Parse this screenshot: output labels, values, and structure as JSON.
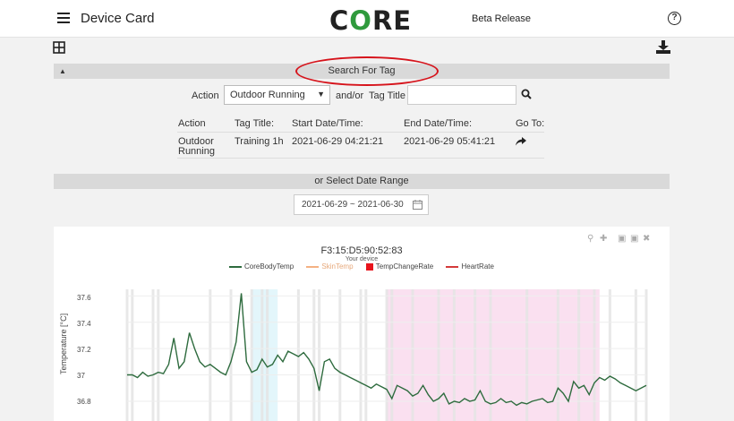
{
  "header": {
    "title": "Device Card",
    "logo_text_1": "C",
    "logo_text_2": "O",
    "logo_text_3": "RE",
    "beta_label": "Beta Release",
    "help_label": "?"
  },
  "toolbar": {
    "icons": [
      "grid-icon",
      "download-icon"
    ]
  },
  "search_panel": {
    "header": "Search For Tag",
    "caret": "▲",
    "action_label": "Action",
    "action_value": "Outdoor Running",
    "andor_label": "and/or",
    "tag_title_label": "Tag Title",
    "tag_title_value": "",
    "highlight_color": "#d6131b"
  },
  "results_table": {
    "headers": [
      "Action",
      "Tag Title:",
      "Start Date/Time:",
      "End Date/Time:",
      "Go To:"
    ],
    "rows": [
      {
        "action_line1": "Outdoor",
        "action_line2": "Running",
        "tag_title": "Training 1h",
        "start": "2021-06-29 04:21:21",
        "end": "2021-06-29 05:41:21"
      }
    ]
  },
  "date_panel": {
    "header": "or Select Date Range",
    "range_value": "2021-06-29 ~ 2021-06-30"
  },
  "chart_controls": [
    "zoom-icon",
    "pan-icon",
    "zoom-in-icon",
    "zoom-out-icon",
    "reset-axes-icon"
  ],
  "chart_data": {
    "type": "line",
    "title": "F3:15:D5:90:52:83",
    "subtitle": "Your device",
    "ylabel": "Temperature [°C]",
    "ylim": [
      36.65,
      37.65
    ],
    "yticks": [
      "37.6",
      "37.4",
      "37.2",
      "37",
      "36.8"
    ],
    "legend": [
      {
        "name": "CoreBodyTemp",
        "color": "#2e6b3e",
        "kind": "line"
      },
      {
        "name": "SkinTemp",
        "color": "#f4b183",
        "kind": "line"
      },
      {
        "name": "TempChangeRate",
        "color": "#e8141c",
        "kind": "box"
      },
      {
        "name": "HeartRate",
        "color": "#d43a3a",
        "kind": "line"
      }
    ],
    "series": [
      {
        "name": "CoreBodyTemp",
        "x": [
          0,
          1,
          2,
          3,
          4,
          5,
          6,
          7,
          8,
          9,
          10,
          11,
          12,
          13,
          14,
          15,
          16,
          17,
          18,
          19,
          20,
          21,
          22,
          23,
          24,
          25,
          26,
          27,
          28,
          29,
          30,
          31,
          32,
          33,
          34,
          35,
          36,
          37,
          38,
          39,
          40,
          41,
          42,
          43,
          44,
          45,
          46,
          47,
          48,
          49,
          50,
          51,
          52,
          53,
          54,
          55,
          56,
          57,
          58,
          59,
          60,
          61,
          62,
          63,
          64,
          65,
          66,
          67,
          68,
          69,
          70,
          71,
          72,
          73,
          74,
          75,
          76,
          77,
          78,
          79,
          80,
          81,
          82,
          83,
          84,
          85,
          86,
          87,
          88,
          89,
          90,
          91,
          92,
          93,
          94,
          95,
          96,
          97,
          98,
          99,
          100
        ],
        "values": [
          37.0,
          37.0,
          36.98,
          37.02,
          36.99,
          37.0,
          37.02,
          37.01,
          37.08,
          37.28,
          37.05,
          37.1,
          37.32,
          37.2,
          37.1,
          37.06,
          37.08,
          37.05,
          37.02,
          37.0,
          37.1,
          37.25,
          37.62,
          37.1,
          37.02,
          37.04,
          37.12,
          37.06,
          37.08,
          37.15,
          37.1,
          37.18,
          37.16,
          37.14,
          37.17,
          37.12,
          37.05,
          36.88,
          37.1,
          37.12,
          37.05,
          37.02,
          37.0,
          36.98,
          36.96,
          36.94,
          36.92,
          36.9,
          36.93,
          36.91,
          36.89,
          36.82,
          36.92,
          36.9,
          36.88,
          36.84,
          36.86,
          36.92,
          36.85,
          36.8,
          36.82,
          36.86,
          36.78,
          36.8,
          36.79,
          36.82,
          36.8,
          36.81,
          36.88,
          36.8,
          36.78,
          36.79,
          36.82,
          36.79,
          36.8,
          36.77,
          36.79,
          36.78,
          36.8,
          36.81,
          36.82,
          36.79,
          36.8,
          36.9,
          36.86,
          36.8,
          36.95,
          36.9,
          36.92,
          36.85,
          36.94,
          36.98,
          36.96,
          36.99,
          36.97,
          36.94,
          36.92,
          36.9,
          36.88,
          36.9,
          36.92
        ]
      }
    ],
    "shaded_regions": [
      {
        "x0": 24,
        "x1": 29,
        "color": "#e3f6fb"
      },
      {
        "x0": 50,
        "x1": 91,
        "color": "#fae0f0"
      }
    ],
    "gray_marks_x": [
      0,
      1,
      5,
      6,
      16,
      20,
      24,
      26,
      27,
      33,
      36,
      37,
      41,
      45,
      46,
      50,
      51,
      55,
      60,
      63,
      67,
      70,
      77,
      83,
      87,
      90,
      93,
      98,
      100
    ]
  }
}
